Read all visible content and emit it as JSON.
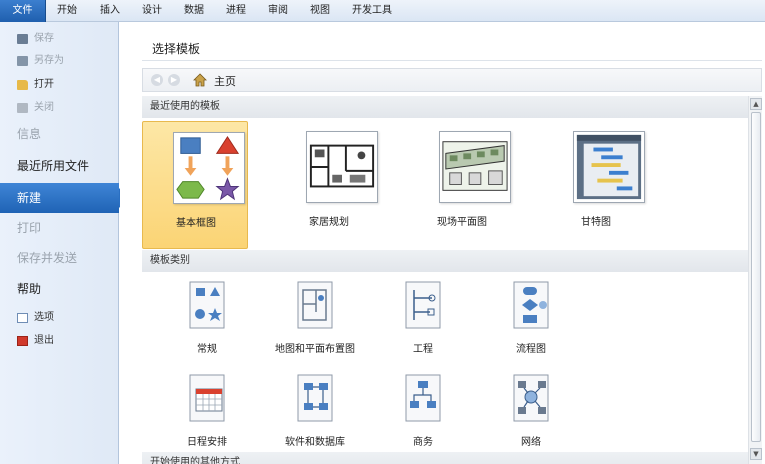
{
  "ribbon": {
    "tabs": [
      {
        "label": "文件",
        "active": true
      },
      {
        "label": "开始"
      },
      {
        "label": "插入"
      },
      {
        "label": "设计"
      },
      {
        "label": "数据"
      },
      {
        "label": "进程"
      },
      {
        "label": "审阅"
      },
      {
        "label": "视图"
      },
      {
        "label": "开发工具"
      }
    ]
  },
  "nav": {
    "save": "保存",
    "save_as": "另存为",
    "open": "打开",
    "close": "关闭",
    "info": "信息",
    "recent": "最近所用文件",
    "new": "新建",
    "print": "打印",
    "save_send": "保存并发送",
    "help": "帮助",
    "options": "选项",
    "exit": "退出"
  },
  "main": {
    "title": "选择模板",
    "breadcrumb": {
      "home": "主页"
    },
    "recent_section": "最近使用的模板",
    "recent_templates": [
      {
        "label": "基本框图",
        "icon": "basic-diagram-icon",
        "selected": true
      },
      {
        "label": "家居规划",
        "icon": "home-plan-icon"
      },
      {
        "label": "现场平面图",
        "icon": "site-plan-icon"
      },
      {
        "label": "甘特图",
        "icon": "gantt-chart-icon"
      }
    ],
    "category_section": "模板类别",
    "categories": [
      {
        "label": "常规",
        "icon": "general-icon"
      },
      {
        "label": "地图和平面布置图",
        "icon": "maps-floorplans-icon"
      },
      {
        "label": "工程",
        "icon": "engineering-icon"
      },
      {
        "label": "流程图",
        "icon": "flowchart-icon"
      },
      {
        "label": "日程安排",
        "icon": "schedule-icon"
      },
      {
        "label": "软件和数据库",
        "icon": "software-database-icon"
      },
      {
        "label": "商务",
        "icon": "business-icon"
      },
      {
        "label": "网络",
        "icon": "network-icon"
      }
    ],
    "other_section": "开始使用的其他方式"
  },
  "colors": {
    "accent": "#2a6fc2",
    "selected": "#fbd475"
  }
}
